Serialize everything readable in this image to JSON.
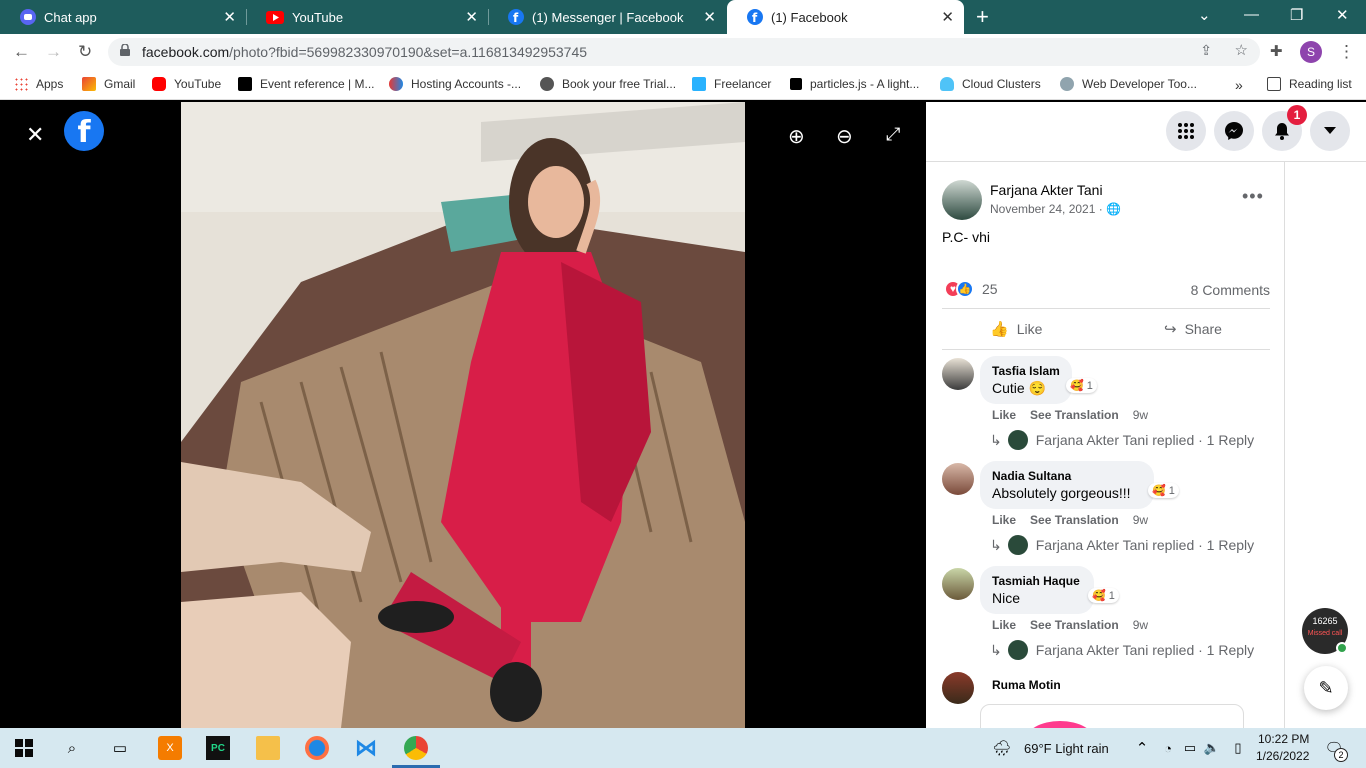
{
  "browser": {
    "tabs": [
      {
        "label": "Chat app",
        "icon": "discord-icon"
      },
      {
        "label": "YouTube",
        "icon": "youtube-icon"
      },
      {
        "label": "(1) Messenger | Facebook",
        "icon": "facebook-icon"
      },
      {
        "label": "(1) Facebook",
        "icon": "facebook-icon",
        "active": true
      }
    ],
    "url_host": "facebook.com",
    "url_path": "/photo?fbid=569982330970190&set=a.116813492953745",
    "profile_initial": "S",
    "bookmarks": [
      {
        "label": "Apps",
        "icon": "apps-grid-icon"
      },
      {
        "label": "Gmail",
        "icon": "gmail-icon"
      },
      {
        "label": "YouTube",
        "icon": "youtube-icon"
      },
      {
        "label": "Event reference | M...",
        "icon": "mdn-icon"
      },
      {
        "label": "Hosting Accounts -...",
        "icon": "infinity-icon"
      },
      {
        "label": "Book your free Trial...",
        "icon": "globe-icon"
      },
      {
        "label": "Freelancer",
        "icon": "freelancer-icon"
      },
      {
        "label": "particles.js - A light...",
        "icon": "particles-icon"
      },
      {
        "label": "Cloud Clusters",
        "icon": "cloud-icon"
      },
      {
        "label": "Web Developer Too...",
        "icon": "webdev-icon"
      }
    ],
    "reading_list": "Reading list"
  },
  "post": {
    "author": "Farjana Akter Tani",
    "date": "November 24, 2021 ·",
    "caption": "P.C- vhi",
    "reaction_count": "25",
    "comments_count": "8 Comments",
    "like_label": "Like",
    "share_label": "Share",
    "notification_count": "1"
  },
  "comments": [
    {
      "name": "Tasfia Islam",
      "text": "Cutie 😌",
      "reaction": "1",
      "like": "Like",
      "translate": "See Translation",
      "ago": "9w",
      "reply": "Farjana Akter Tani replied · 1 Reply"
    },
    {
      "name": "Nadia Sultana",
      "text": "Absolutely gorgeous!!!",
      "reaction": "1",
      "like": "Like",
      "translate": "See Translation",
      "ago": "9w",
      "reply": "Farjana Akter Tani replied · 1 Reply"
    },
    {
      "name": "Tasmiah Haque",
      "text": "Nice",
      "reaction": "1",
      "like": "Like",
      "translate": "See Translation",
      "ago": "9w",
      "reply": "Farjana Akter Tani replied · 1 Reply"
    },
    {
      "name": "Ruma Motin"
    }
  ],
  "missed_call": {
    "count": "16265",
    "label": "Missed call"
  },
  "taskbar": {
    "weather": "69°F  Light rain",
    "time": "10:22 PM",
    "date": "1/26/2022",
    "notif_count": "2"
  },
  "colors": {
    "tabbar": "#1e5c5c",
    "fb_blue": "#1877f2",
    "dress_red": "#d81e48"
  }
}
